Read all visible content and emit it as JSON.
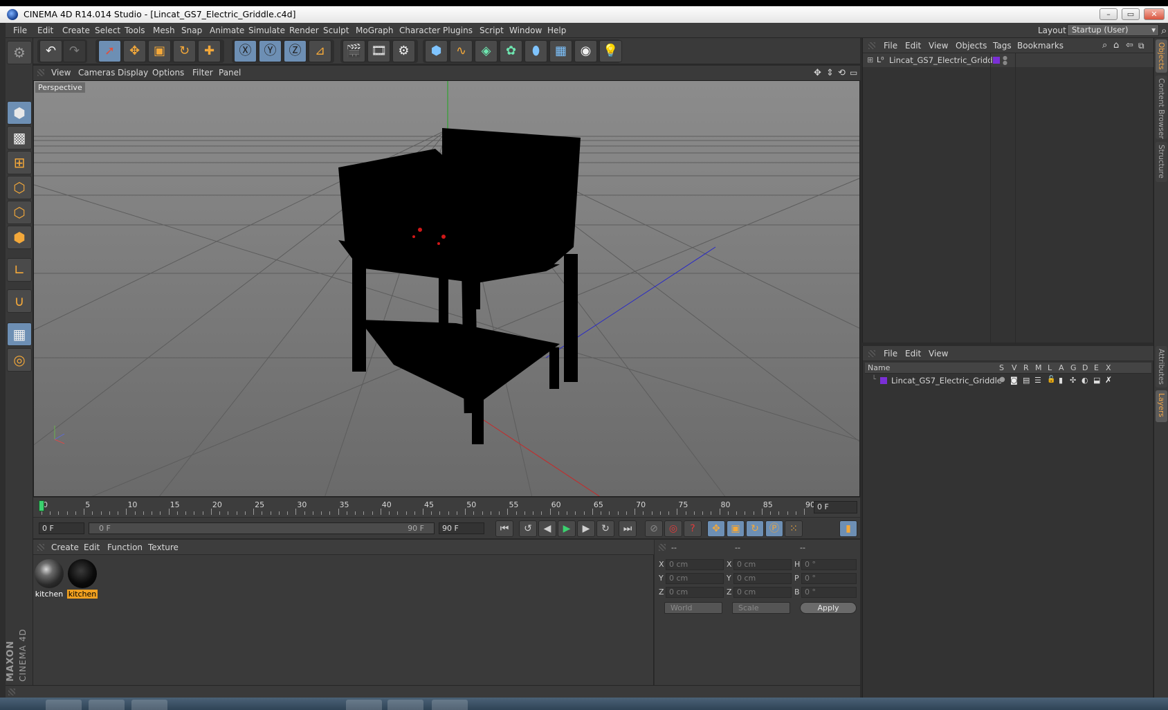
{
  "window": {
    "title": "CINEMA 4D R14.014 Studio - [Lincat_GS7_Electric_Griddle.c4d]",
    "min": "–",
    "max": "▭",
    "close": "✕"
  },
  "menu": [
    "File",
    "Edit",
    "Create",
    "Select",
    "Tools",
    "Mesh",
    "Snap",
    "Animate",
    "Simulate",
    "Render",
    "Sculpt",
    "MoGraph",
    "Character",
    "Plugins",
    "Script",
    "Window",
    "Help"
  ],
  "layout": {
    "label": "Layout:",
    "value": "Startup (User)"
  },
  "viewport": {
    "menu": [
      "View",
      "Cameras",
      "Display",
      "Options",
      "Filter",
      "Panel"
    ],
    "label": "Perspective"
  },
  "timeline": {
    "ticks": [
      0,
      5,
      10,
      15,
      20,
      25,
      30,
      35,
      40,
      45,
      50,
      55,
      60,
      65,
      70,
      75,
      80,
      85,
      90
    ],
    "current": "0 F"
  },
  "transport": {
    "start": "0 F",
    "range_start": "0 F",
    "range_end": "90 F",
    "end": "90 F"
  },
  "materials": {
    "menu": [
      "Create",
      "Edit",
      "Function",
      "Texture"
    ],
    "items": [
      {
        "name": "kitchen"
      },
      {
        "name": "kitchen"
      }
    ]
  },
  "coords": {
    "headers": [
      "--",
      "--",
      "--"
    ],
    "rows": [
      {
        "a": "X",
        "av": "0 cm",
        "b": "X",
        "bv": "0 cm",
        "c": "H",
        "cv": "0 °"
      },
      {
        "a": "Y",
        "av": "0 cm",
        "b": "Y",
        "bv": "0 cm",
        "c": "P",
        "cv": "0 °"
      },
      {
        "a": "Z",
        "av": "0 cm",
        "b": "Z",
        "bv": "0 cm",
        "c": "B",
        "cv": "0 °"
      }
    ],
    "world": "World",
    "scale": "Scale",
    "apply": "Apply"
  },
  "objects": {
    "menu": [
      "File",
      "Edit",
      "View",
      "Objects",
      "Tags",
      "Bookmarks"
    ],
    "item": "Lincat_GS7_Electric_Griddle",
    "color": "#7a2fd6"
  },
  "layers": {
    "menu": [
      "File",
      "Edit",
      "View"
    ],
    "cols": [
      "Name",
      "S",
      "V",
      "R",
      "M",
      "L",
      "A",
      "G",
      "D",
      "E",
      "X"
    ],
    "item": "Lincat_GS7_Electric_Griddle"
  },
  "side_tabs": [
    "Objects",
    "Content Browser",
    "Structure",
    "Attributes",
    "Layers"
  ],
  "branding": {
    "maxon": "MAXON",
    "c4d": "CINEMA 4D"
  }
}
